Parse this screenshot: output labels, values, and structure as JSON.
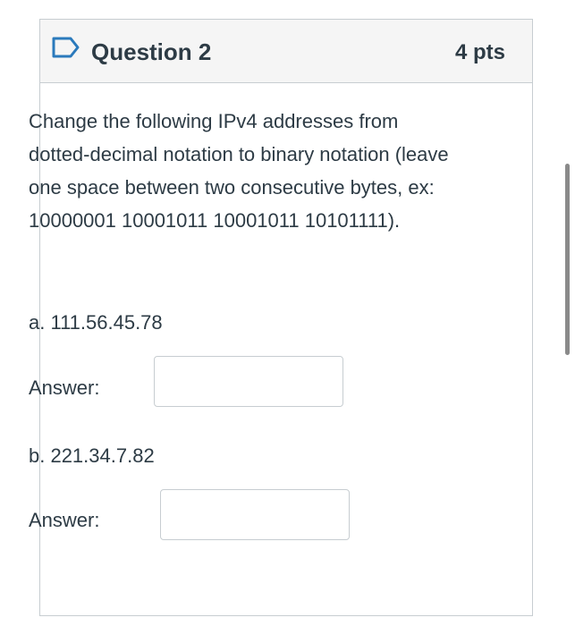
{
  "question": {
    "title": "Question 2",
    "points": "4 pts",
    "text": "Change the following IPv4 addresses from dotted-decimal notation to binary notation (leave one space between two consecutive bytes, ex: 10000001 10001011 10001011 10101111).",
    "parts": [
      {
        "label": "a. 111.56.45.78",
        "answer_label": "Answer:",
        "answer_value": ""
      },
      {
        "label": "b. 221.34.7.82",
        "answer_label": "Answer:",
        "answer_value": ""
      }
    ]
  },
  "icons": {
    "flag": "bookmark-flag-icon"
  },
  "colors": {
    "text": "#2d3b45",
    "border": "#c7cdd1",
    "header_bg": "#f5f5f5",
    "flag": "#2b7abc"
  }
}
